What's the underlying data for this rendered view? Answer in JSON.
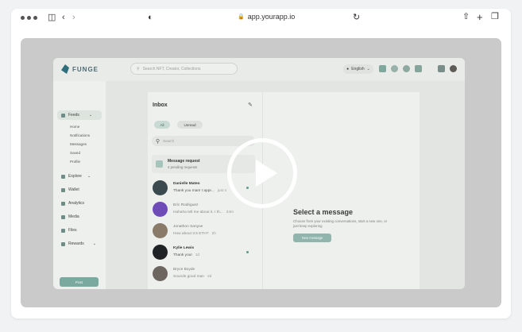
{
  "browser": {
    "url": "app.yourapp.io",
    "icons": [
      "sidebar-icon",
      "back-icon",
      "forward-icon",
      "shield-icon",
      "lock-icon",
      "reload-icon",
      "share-icon",
      "new-tab-icon",
      "tabs-icon"
    ]
  },
  "app": {
    "brand": "FUNGE",
    "search_placeholder": "Search NFT, Creator, Collections",
    "language": "English",
    "sidebar": {
      "feeds_label": "Feeds",
      "feeds_sub": [
        "Home",
        "Notifications",
        "Messages",
        "Saved",
        "Profile"
      ],
      "explore_label": "Explore",
      "wallet_label": "Wallet",
      "analytics_label": "Analytics",
      "media_label": "Media",
      "files_label": "Files",
      "rewards_label": "Rewards",
      "post_button": "Post"
    },
    "inbox": {
      "title": "Inbox",
      "filters": [
        "All",
        "Unread"
      ],
      "search_placeholder": "Search",
      "request_title": "Message request",
      "request_sub": "4 pending requests",
      "conversations": [
        {
          "name": "Danielle Mateo",
          "message": "Thank you man! I appr...",
          "time": "just n",
          "unread": true,
          "avatar_color": "#3a4a4e"
        },
        {
          "name": "Eric Rodriguez",
          "message": "Hahaha tell me about it. I th...",
          "time": "34m",
          "unread": false,
          "avatar_color": "#6f4bb8"
        },
        {
          "name": "Jonathon Sanyoe",
          "message": "How about 3.5 ETH?",
          "time": "2h",
          "unread": false,
          "avatar_color": "#8a7a6a"
        },
        {
          "name": "Kylie Lewis",
          "message": "Thank you!",
          "time": "1d",
          "unread": true,
          "avatar_color": "#1f2326"
        },
        {
          "name": "Bryce Boyde",
          "message": "Sounds good man",
          "time": "2d",
          "unread": false,
          "avatar_color": "#6c6560"
        }
      ]
    },
    "detail": {
      "title": "Select a message",
      "subtitle": "Choose from your existing conversations, start a new one, or just keep exploring",
      "button": "New message"
    }
  },
  "colors": {
    "accent": "#7aa9a0",
    "overlay": "#c9cac9"
  }
}
